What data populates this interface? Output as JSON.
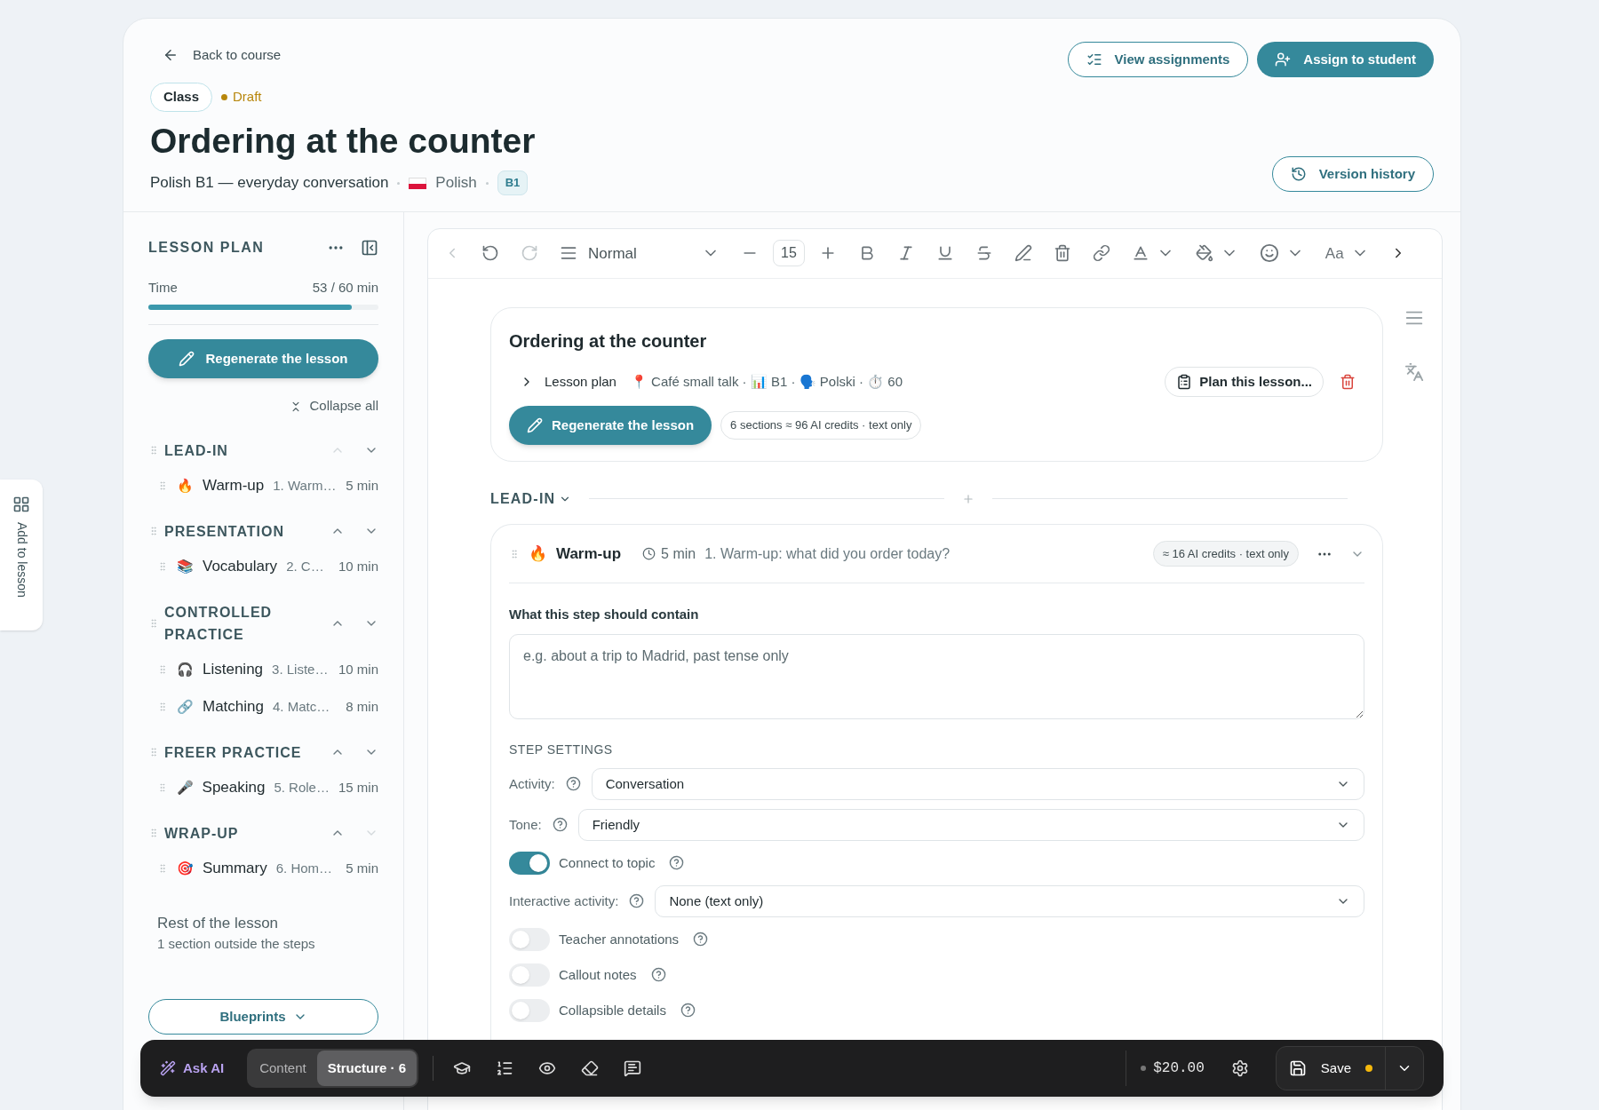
{
  "side_tab": {
    "label": "Add to lesson"
  },
  "header": {
    "back": "Back to course",
    "type_badge": "Class",
    "status": {
      "label": "Draft",
      "color": "#b7860b"
    },
    "title": "Ordering at the counter",
    "subtitle": "Polish B1 — everyday conversation",
    "language": "Polish",
    "level": "B1",
    "buttons": [
      {
        "kind": "outline",
        "label": "View assignments"
      },
      {
        "kind": "solid",
        "label": "Assign to student"
      }
    ],
    "version_history": "Version history"
  },
  "sidebar": {
    "title": "LESSON PLAN",
    "time_label": "Time",
    "time_value": "53 / 60 min",
    "level": 0.883,
    "regenerate": "Regenerate the lesson",
    "collapse_all": "Collapse all",
    "sections": [
      {
        "title": "LEAD-IN",
        "can_move_up": false,
        "can_move_down": true,
        "items": [
          {
            "emoji": "🔥",
            "name": "Warm-up",
            "desc": "1. Warm…",
            "duration": "5 min"
          }
        ]
      },
      {
        "title": "PRESENTATION",
        "can_move_up": true,
        "can_move_down": true,
        "items": [
          {
            "emoji": "📚",
            "name": "Vocabulary",
            "desc": "2. C…",
            "duration": "10 min"
          }
        ]
      },
      {
        "title": "CONTROLLED PRACTICE",
        "can_move_up": true,
        "can_move_down": true,
        "items": [
          {
            "emoji": "🎧",
            "name": "Listening",
            "desc": "3. Liste…",
            "duration": "10 min"
          },
          {
            "emoji": "🔗",
            "name": "Matching",
            "desc": "4. Matc…",
            "duration": "8 min"
          }
        ]
      },
      {
        "title": "FREER PRACTICE",
        "can_move_up": true,
        "can_move_down": true,
        "items": [
          {
            "emoji": "🎤",
            "name": "Speaking",
            "desc": "5. Role…",
            "duration": "15 min"
          }
        ]
      },
      {
        "title": "WRAP-UP",
        "can_move_up": true,
        "can_move_down": false,
        "items": [
          {
            "emoji": "🎯",
            "name": "Summary",
            "desc": "6. Hom…",
            "duration": "5 min"
          }
        ]
      }
    ],
    "rest_title": "Rest of the lesson",
    "rest_sub": "1 section outside the steps",
    "blueprints": "Blueprints"
  },
  "toolbar": {
    "block_style": "Normal",
    "font_size": "15",
    "case_label": "Aa"
  },
  "doc_card": {
    "title": "Ordering at the counter",
    "lesson_plan": "Lesson plan",
    "meta": "📍 Café small talk · 📊 B1 · 🗣️ Polski · ⏱️ 60",
    "plan_button": "Plan this lesson...",
    "regenerate": "Regenerate the lesson",
    "credits": "6 sections ≈ 96 AI credits · text only"
  },
  "section_divider": {
    "title": "LEAD-IN"
  },
  "step": {
    "emoji": "🔥",
    "name": "Warm-up",
    "duration": "5 min",
    "description": "1. Warm-up: what did you order today?",
    "credits": "≈ 16 AI credits · text only",
    "field_label": "What this step should contain",
    "placeholder": "e.g. about a trip to Madrid, past tense only",
    "settings_title": "STEP SETTINGS",
    "settings": [
      {
        "kind": "select",
        "label": "Activity:",
        "value": "Conversation"
      },
      {
        "kind": "select",
        "label": "Tone:",
        "value": "Friendly"
      },
      {
        "kind": "toggle",
        "label": "Connect to topic",
        "on": true
      },
      {
        "kind": "select",
        "label": "Interactive activity:",
        "value": "None (text only)"
      },
      {
        "kind": "toggle",
        "label": "Teacher annotations",
        "on": false
      },
      {
        "kind": "toggle",
        "label": "Callout notes",
        "on": false
      },
      {
        "kind": "toggle",
        "label": "Collapsible details",
        "on": false
      }
    ]
  },
  "bottom_bar": {
    "ask_ai": "Ask AI",
    "tabs": [
      {
        "label": "Content",
        "selected": false
      },
      {
        "label": "Structure · 6",
        "selected": true
      }
    ],
    "price": "$20.00",
    "save": "Save",
    "unsaved": true
  }
}
